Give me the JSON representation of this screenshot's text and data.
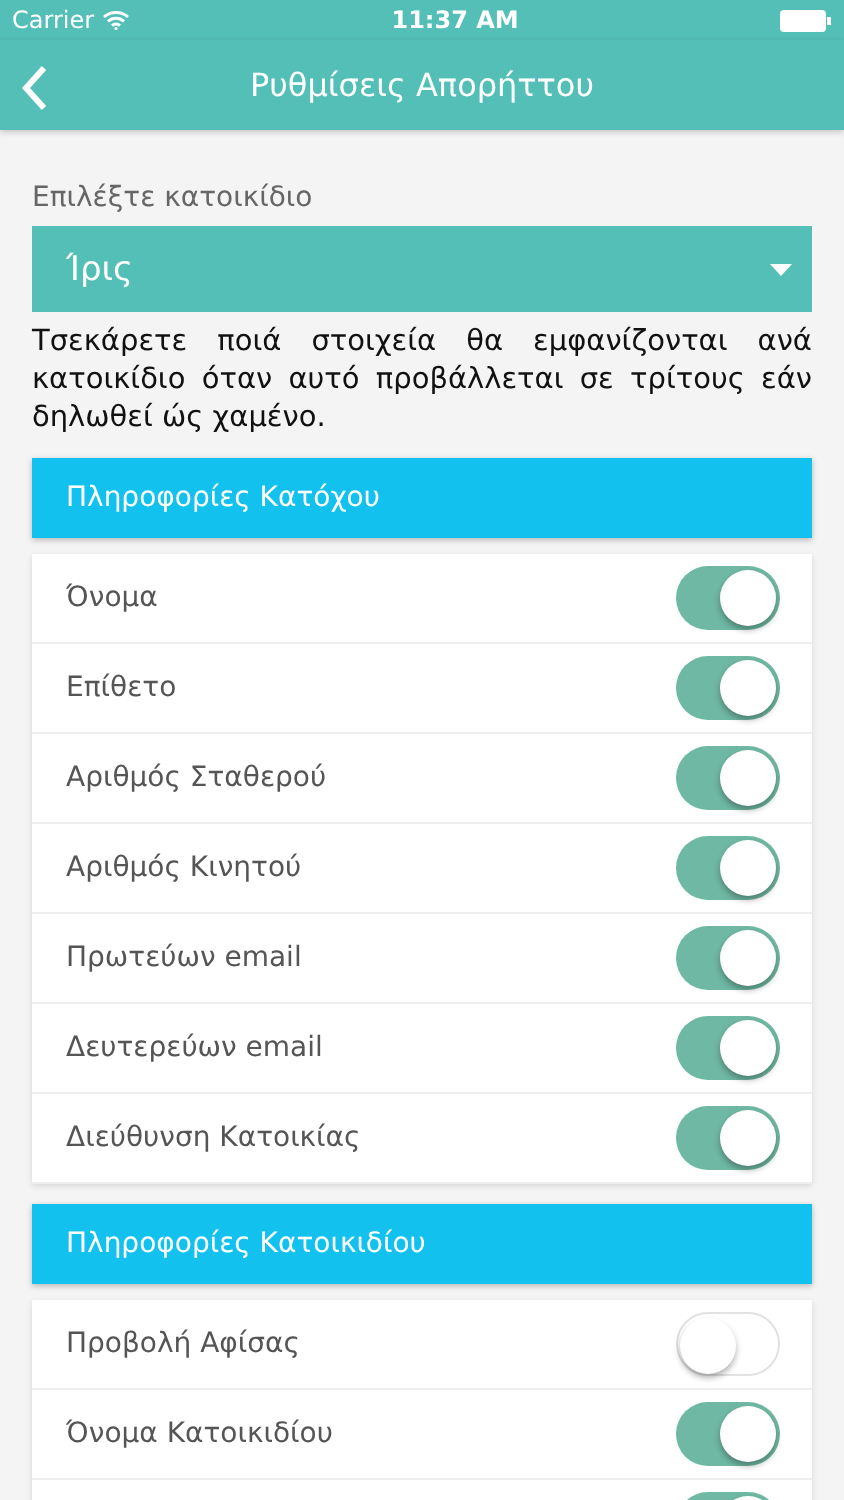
{
  "status_bar": {
    "carrier": "Carrier",
    "time": "11:37 AM"
  },
  "nav": {
    "title": "Ρυθμίσεις Απορήττου"
  },
  "pet_picker": {
    "label": "Επιλέξτε κατοικίδιο",
    "value": "Ίρις"
  },
  "description": "Τσεκάρετε ποιά στοιχεία θα εμφανίζονται ανά κατοικίδιο όταν αυτό προβάλλεται σε τρίτους εάν δηλωθεί ώς χαμένο.",
  "sections": [
    {
      "title": "Πληροφορίες Κατόχου",
      "rows": [
        {
          "label": "Όνομα",
          "on": true
        },
        {
          "label": "Επίθετο",
          "on": true
        },
        {
          "label": "Αριθμός Σταθερού",
          "on": true
        },
        {
          "label": "Αριθμός Κινητού",
          "on": true
        },
        {
          "label": "Πρωτεύων email",
          "on": true
        },
        {
          "label": "Δευτερεύων email",
          "on": true
        },
        {
          "label": "Διεύθυνση Κατοικίας",
          "on": true
        }
      ]
    },
    {
      "title": "Πληροφορίες Κατοικιδίου",
      "rows": [
        {
          "label": "Προβολή Αφίσας",
          "on": false
        },
        {
          "label": "Όνομα Κατοικιδίου",
          "on": true
        },
        {
          "on": true
        }
      ]
    }
  ]
}
